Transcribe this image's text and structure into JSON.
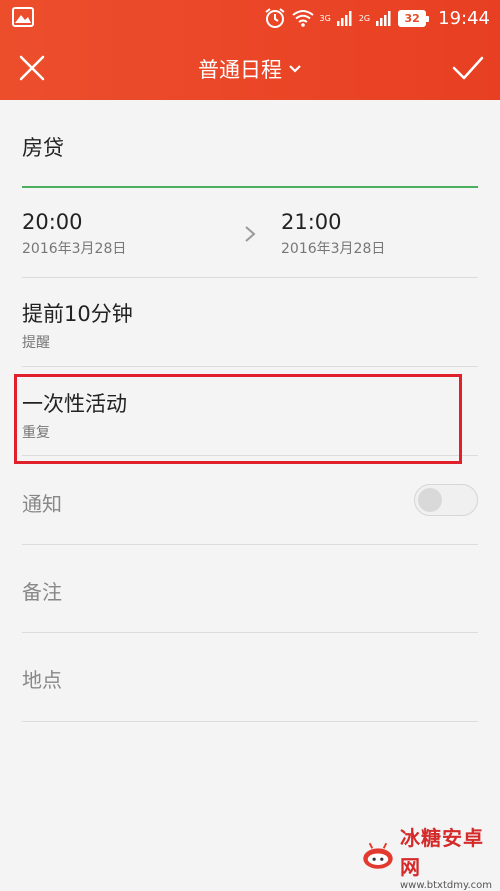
{
  "status_bar": {
    "network_labels": [
      "3G",
      "2G"
    ],
    "battery_level": "32",
    "time": "19:44"
  },
  "toolbar": {
    "title": "普通日程",
    "close_icon": "close-icon",
    "confirm_icon": "check-icon"
  },
  "event": {
    "title": "房贷",
    "start": {
      "time": "20:00",
      "date": "2016年3月28日"
    },
    "end": {
      "time": "21:00",
      "date": "2016年3月28日"
    },
    "reminder": {
      "value": "提前10分钟",
      "label": "提醒"
    },
    "repeat": {
      "value": "一次性活动",
      "label": "重复"
    },
    "notify": {
      "label": "通知",
      "enabled": false
    },
    "note": {
      "label": "备注"
    },
    "location": {
      "label": "地点"
    }
  },
  "colors": {
    "header": "#e84a27",
    "accent_underline": "#4caf60",
    "highlight": "#e0202a"
  },
  "watermark": {
    "title": "冰糖安卓网",
    "url": "www.btxtdmy.com"
  }
}
